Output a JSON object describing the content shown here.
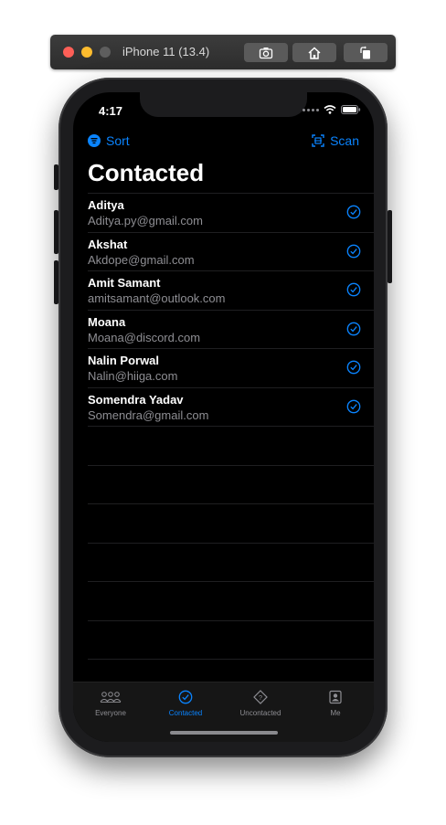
{
  "simulator": {
    "title": "iPhone 11 (13.4)"
  },
  "status_bar": {
    "time": "4:17"
  },
  "nav": {
    "left_label": "Sort",
    "right_label": "Scan"
  },
  "page": {
    "title": "Contacted"
  },
  "contacts": [
    {
      "name": "Aditya",
      "email": "Aditya.py@gmail.com"
    },
    {
      "name": "Akshat",
      "email": "Akdope@gmail.com"
    },
    {
      "name": "Amit Samant",
      "email": "amitsamant@outlook.com"
    },
    {
      "name": "Moana",
      "email": "Moana@discord.com"
    },
    {
      "name": "Nalin Porwal",
      "email": "Nalin@hiiga.com"
    },
    {
      "name": "Somendra Yadav",
      "email": "Somendra@gmail.com"
    }
  ],
  "tabs": [
    {
      "label": "Everyone",
      "icon": "people-icon",
      "active": false
    },
    {
      "label": "Contacted",
      "icon": "checkmark-circle-icon",
      "active": true
    },
    {
      "label": "Uncontacted",
      "icon": "question-diamond-icon",
      "active": false
    },
    {
      "label": "Me",
      "icon": "person-square-icon",
      "active": false
    }
  ],
  "colors": {
    "accent": "#0a84ff",
    "background": "#000000",
    "secondary_text": "#8e8e93"
  }
}
